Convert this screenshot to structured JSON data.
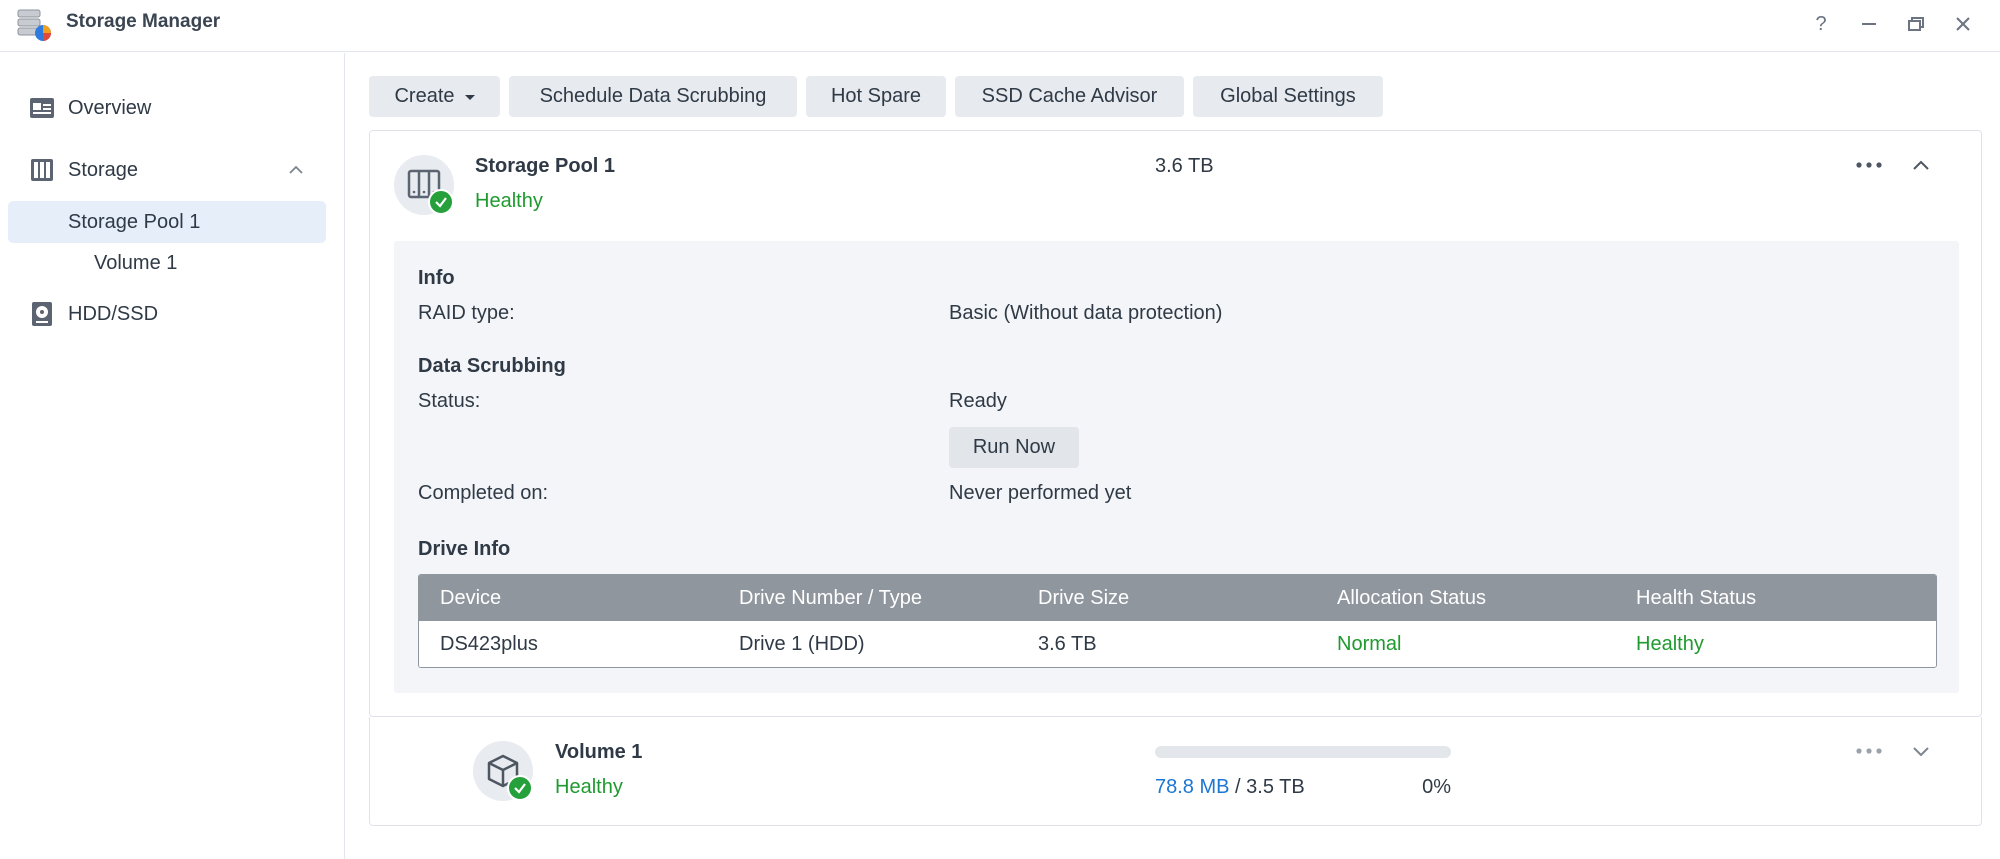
{
  "window": {
    "title": "Storage Manager",
    "help_label": "?"
  },
  "sidebar": {
    "items": [
      {
        "label": "Overview",
        "icon": "overview-icon"
      },
      {
        "label": "Storage",
        "icon": "storage-icon",
        "expanded": true
      },
      {
        "label": "Storage Pool 1",
        "selected": true
      },
      {
        "label": "Volume 1"
      },
      {
        "label": "HDD/SSD",
        "icon": "hdd-icon"
      }
    ]
  },
  "toolbar": {
    "create_label": "Create",
    "schedule_label": "Schedule Data Scrubbing",
    "hot_spare_label": "Hot Spare",
    "ssd_cache_label": "SSD Cache Advisor",
    "global_settings_label": "Global Settings"
  },
  "pool": {
    "name": "Storage Pool 1",
    "status": "Healthy",
    "size": "3.6 TB",
    "info_title": "Info",
    "raid_label": "RAID type:",
    "raid_value": "Basic (Without data protection)",
    "scrub_title": "Data Scrubbing",
    "scrub_status_label": "Status:",
    "scrub_status_value": "Ready",
    "run_now_label": "Run Now",
    "completed_label": "Completed on:",
    "completed_value": "Never performed yet",
    "drive_info_title": "Drive Info",
    "drive_table": {
      "headers": [
        "Device",
        "Drive Number / Type",
        "Drive Size",
        "Allocation Status",
        "Health Status"
      ],
      "rows": [
        [
          "DS423plus",
          "Drive 1 (HDD)",
          "3.6 TB",
          "Normal",
          "Healthy"
        ]
      ]
    }
  },
  "volume": {
    "name": "Volume 1",
    "status": "Healthy",
    "used": "78.8 MB",
    "separator": " / ",
    "total": "3.5 TB",
    "percent": "0%",
    "usage_fraction": 0.0
  },
  "colors": {
    "healthy_green": "#1f9a2f",
    "accent_blue": "#1c76d2",
    "selected_bg": "#e6eefa"
  }
}
